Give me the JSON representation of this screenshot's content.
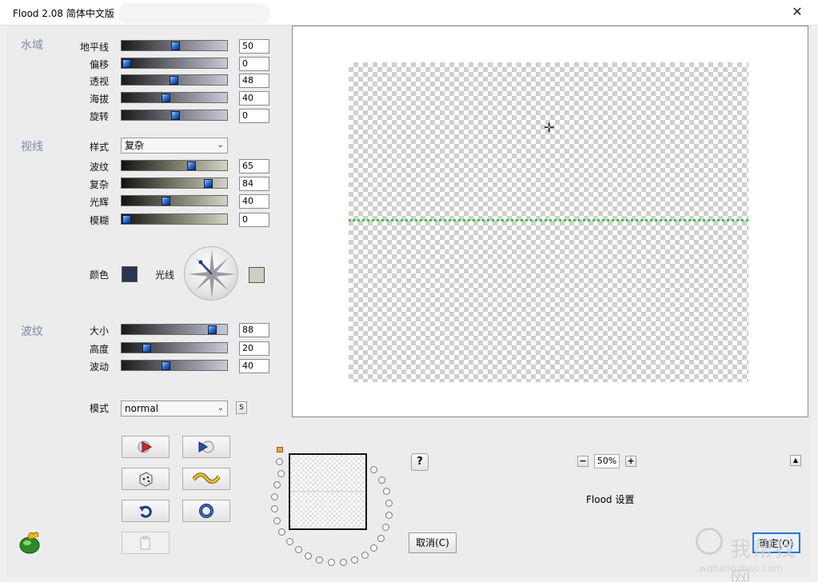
{
  "window": {
    "title": "Flood 2.08 简体中文版",
    "close_glyph": "✕"
  },
  "water": {
    "label": "水域",
    "rows": [
      {
        "label": "地平线",
        "value": "50"
      },
      {
        "label": "偏移",
        "value": "0"
      },
      {
        "label": "透视",
        "value": "48"
      },
      {
        "label": "海拔",
        "value": "40"
      },
      {
        "label": "旋转",
        "value": "0"
      }
    ]
  },
  "sight": {
    "label": "视线",
    "style_label": "样式",
    "style_value": "复杂",
    "rows": [
      {
        "label": "波纹",
        "value": "65"
      },
      {
        "label": "复杂",
        "value": "84"
      },
      {
        "label": "光辉",
        "value": "40"
      },
      {
        "label": "模糊",
        "value": "0"
      }
    ],
    "color_label": "颜色",
    "light_label": "光线",
    "colors": {
      "water_color": "#2a3550",
      "light_color": "#cfcdc2"
    }
  },
  "ripple": {
    "label": "波纹",
    "rows": [
      {
        "label": "大小",
        "value": "88"
      },
      {
        "label": "高度",
        "value": "20"
      },
      {
        "label": "波动",
        "value": "40"
      }
    ]
  },
  "mode": {
    "label": "模式",
    "value": "normal",
    "s_button": "S"
  },
  "preview": {
    "zoom": "50%",
    "zoom_minus": "−",
    "zoom_plus": "+",
    "collapse": "▲",
    "help": "?",
    "settings_label": "Flood 设置"
  },
  "buttons": {
    "cancel": "取消(C)",
    "ok": "确定(O)"
  },
  "watermark": {
    "text": "我帮找网",
    "url": "wobangzhao.com"
  }
}
